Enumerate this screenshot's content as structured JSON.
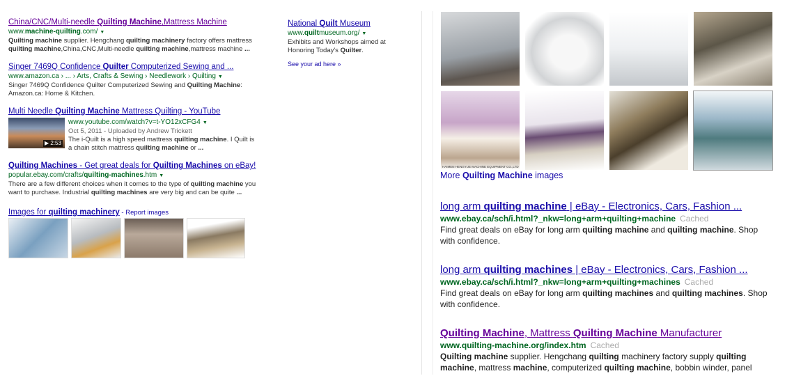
{
  "left": {
    "results": [
      {
        "title_parts": [
          "China/CNC/Multi-needle ",
          "Quilting Machine",
          ",Mattress Machine"
        ],
        "url_parts": [
          "www.",
          "machine-quilting",
          ".com/"
        ],
        "snippet_parts": [
          "Quilting machine",
          " supplier. Hengchang ",
          "quilting machinery",
          " factory offers mattress ",
          "quilting machine",
          ",China,CNC,Multi-needle ",
          "quilting machine",
          ",mattress machine ",
          "..."
        ]
      },
      {
        "title_parts": [
          "Singer 7469Q Confidence ",
          "Quilter",
          " Computerized Sewing and ..."
        ],
        "url": "www.amazon.ca › ... › Arts, Crafts & Sewing › Needlework › Quilting",
        "snippet_parts": [
          "Singer 7469Q Confidence Quilter Computerized Sewing and ",
          "Quilting Machine",
          ": Amazon.ca: Home & Kitchen."
        ]
      },
      {
        "title_parts": [
          "Multi Needle ",
          "Quilting Machine",
          " Mattress Quilting - YouTube"
        ],
        "url": "www.youtube.com/watch?v=t-YO12xCFG4",
        "meta": "Oct 5, 2011 - Uploaded by Andrew Trickett",
        "duration": "▶ 2:53",
        "snippet_parts": [
          "The i-Quilt is a high speed mattress ",
          "quilting machine",
          ". I Quilt is a chain stitch mattress ",
          "quilting machine",
          " or ",
          "..."
        ]
      },
      {
        "title_parts": [
          "Quilting Machines",
          " - Get great deals for ",
          "Quilting Machines",
          " on eBay!"
        ],
        "url_parts": [
          "popular.ebay.com/crafts/",
          "quilting-machines",
          ".htm"
        ],
        "snippet_parts": [
          "There are a few different choices when it comes to the type of ",
          "quilting machine",
          " you want to purchase. Industrial ",
          "quilting machines",
          " are very big and can be quite ",
          "..."
        ]
      }
    ],
    "images_for": {
      "prefix": "Images for ",
      "keyword": "quilting machinery",
      "report": " - Report images"
    },
    "ad": {
      "title_parts": [
        "National ",
        "Quilt",
        " Museum"
      ],
      "url_parts": [
        "www.",
        "quilt",
        "museum.org/"
      ],
      "snippet_parts": [
        "Exhibits and Workshops aimed at Honoring Today's ",
        "Quilter",
        "."
      ],
      "see_ad": "See your ad here »"
    }
  },
  "right": {
    "more_images": {
      "prefix": "More ",
      "keyword": "Quilting Machine",
      "suffix": " images"
    },
    "results": [
      {
        "title_parts": [
          "long arm ",
          "quilting machine",
          " | eBay - Electronics, Cars, Fashion ..."
        ],
        "url": "www.ebay.ca/sch/i.html?_nkw=long+arm+quilting+machine",
        "cached": "Cached",
        "snippet_parts": [
          "Find great deals on eBay for long arm ",
          "quilting machine",
          " and ",
          "quilting machine",
          ". Shop with confidence."
        ]
      },
      {
        "title_parts": [
          "long arm ",
          "quilting machines",
          " | eBay - Electronics, Cars, Fashion ..."
        ],
        "url": "www.ebay.ca/sch/i.html?_nkw=long+arm+quilting+machines",
        "cached": "Cached",
        "snippet_parts": [
          "Find great deals on eBay for long arm ",
          "quilting machines",
          " and ",
          "quilting machines",
          ". Shop with confidence."
        ]
      },
      {
        "title_parts": [
          "Quilting Machine",
          ", Mattress ",
          "Quilting Machine",
          " Manufacturer"
        ],
        "url": "www.quilting-machine.org/index.htm",
        "cached": "Cached",
        "snippet_parts": [
          "Quilting machine",
          " supplier. Hengchang ",
          "quilting",
          " machinery factory supply ",
          "quilting machine",
          ", mattress ",
          "machine",
          ", computerized ",
          "quilting machine",
          ", bobbin winder, panel"
        ]
      }
    ],
    "grid_caption": "HAIMEN HENGYUE MACHINE EQUIPMENT CO.,LTD"
  }
}
